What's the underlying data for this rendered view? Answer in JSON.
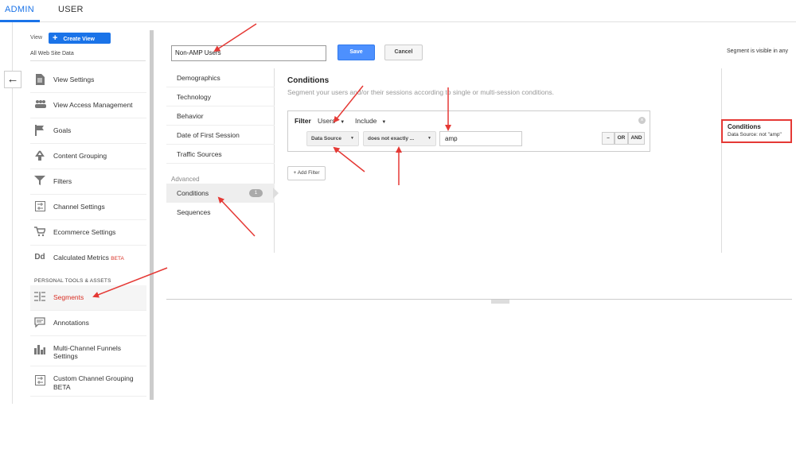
{
  "top_tabs": {
    "admin": "ADMIN",
    "user": "USER"
  },
  "sidebar": {
    "view_label": "View",
    "create_view": "Create View",
    "site_data": "All Web Site Data",
    "items": [
      {
        "label": "View Settings",
        "icon": "document-icon"
      },
      {
        "label": "View Access Management",
        "icon": "people-icon"
      },
      {
        "label": "Goals",
        "icon": "flag-icon"
      },
      {
        "label": "Content Grouping",
        "icon": "grouping-icon"
      },
      {
        "label": "Filters",
        "icon": "filter-icon"
      },
      {
        "label": "Channel Settings",
        "icon": "channel-icon"
      },
      {
        "label": "Ecommerce Settings",
        "icon": "cart-icon"
      },
      {
        "label": "Calculated Metrics",
        "icon": "dd-icon",
        "badge": "BETA"
      }
    ],
    "section_heading": "PERSONAL TOOLS & ASSETS",
    "personal_items": [
      {
        "label": "Segments",
        "icon": "segments-icon",
        "active": true
      },
      {
        "label": "Annotations",
        "icon": "comment-icon"
      },
      {
        "label": "Multi-Channel Funnels",
        "label2": "Settings",
        "icon": "bar-chart-icon"
      },
      {
        "label": "Custom Channel Grouping",
        "icon": "channel-icon",
        "badge": "BETA"
      }
    ]
  },
  "editor": {
    "segment_name": "Non-AMP Users",
    "save": "Save",
    "cancel": "Cancel",
    "visible_text": "Segment is visible in any"
  },
  "categories": {
    "items": [
      "Demographics",
      "Technology",
      "Behavior",
      "Date of First Session",
      "Traffic Sources"
    ],
    "advanced_label": "Advanced",
    "conditions": "Conditions",
    "conditions_count": "1",
    "sequences": "Sequences"
  },
  "conditions": {
    "title": "Conditions",
    "description": "Segment your users and/or their sessions according to single or multi-session conditions.",
    "filter_label": "Filter",
    "scope": "Users",
    "include": "Include",
    "dimension": "Data Source",
    "operator": "does not exactly ...",
    "value": "amp",
    "minus": "–",
    "or": "OR",
    "and": "AND",
    "add_filter": "+ Add Filter"
  },
  "summary": {
    "title": "Conditions",
    "text": "Data Source: not \"amp\""
  },
  "colors": {
    "accent": "#1a73e8",
    "annotation": "#e53935",
    "active_nav": "#d93025"
  }
}
